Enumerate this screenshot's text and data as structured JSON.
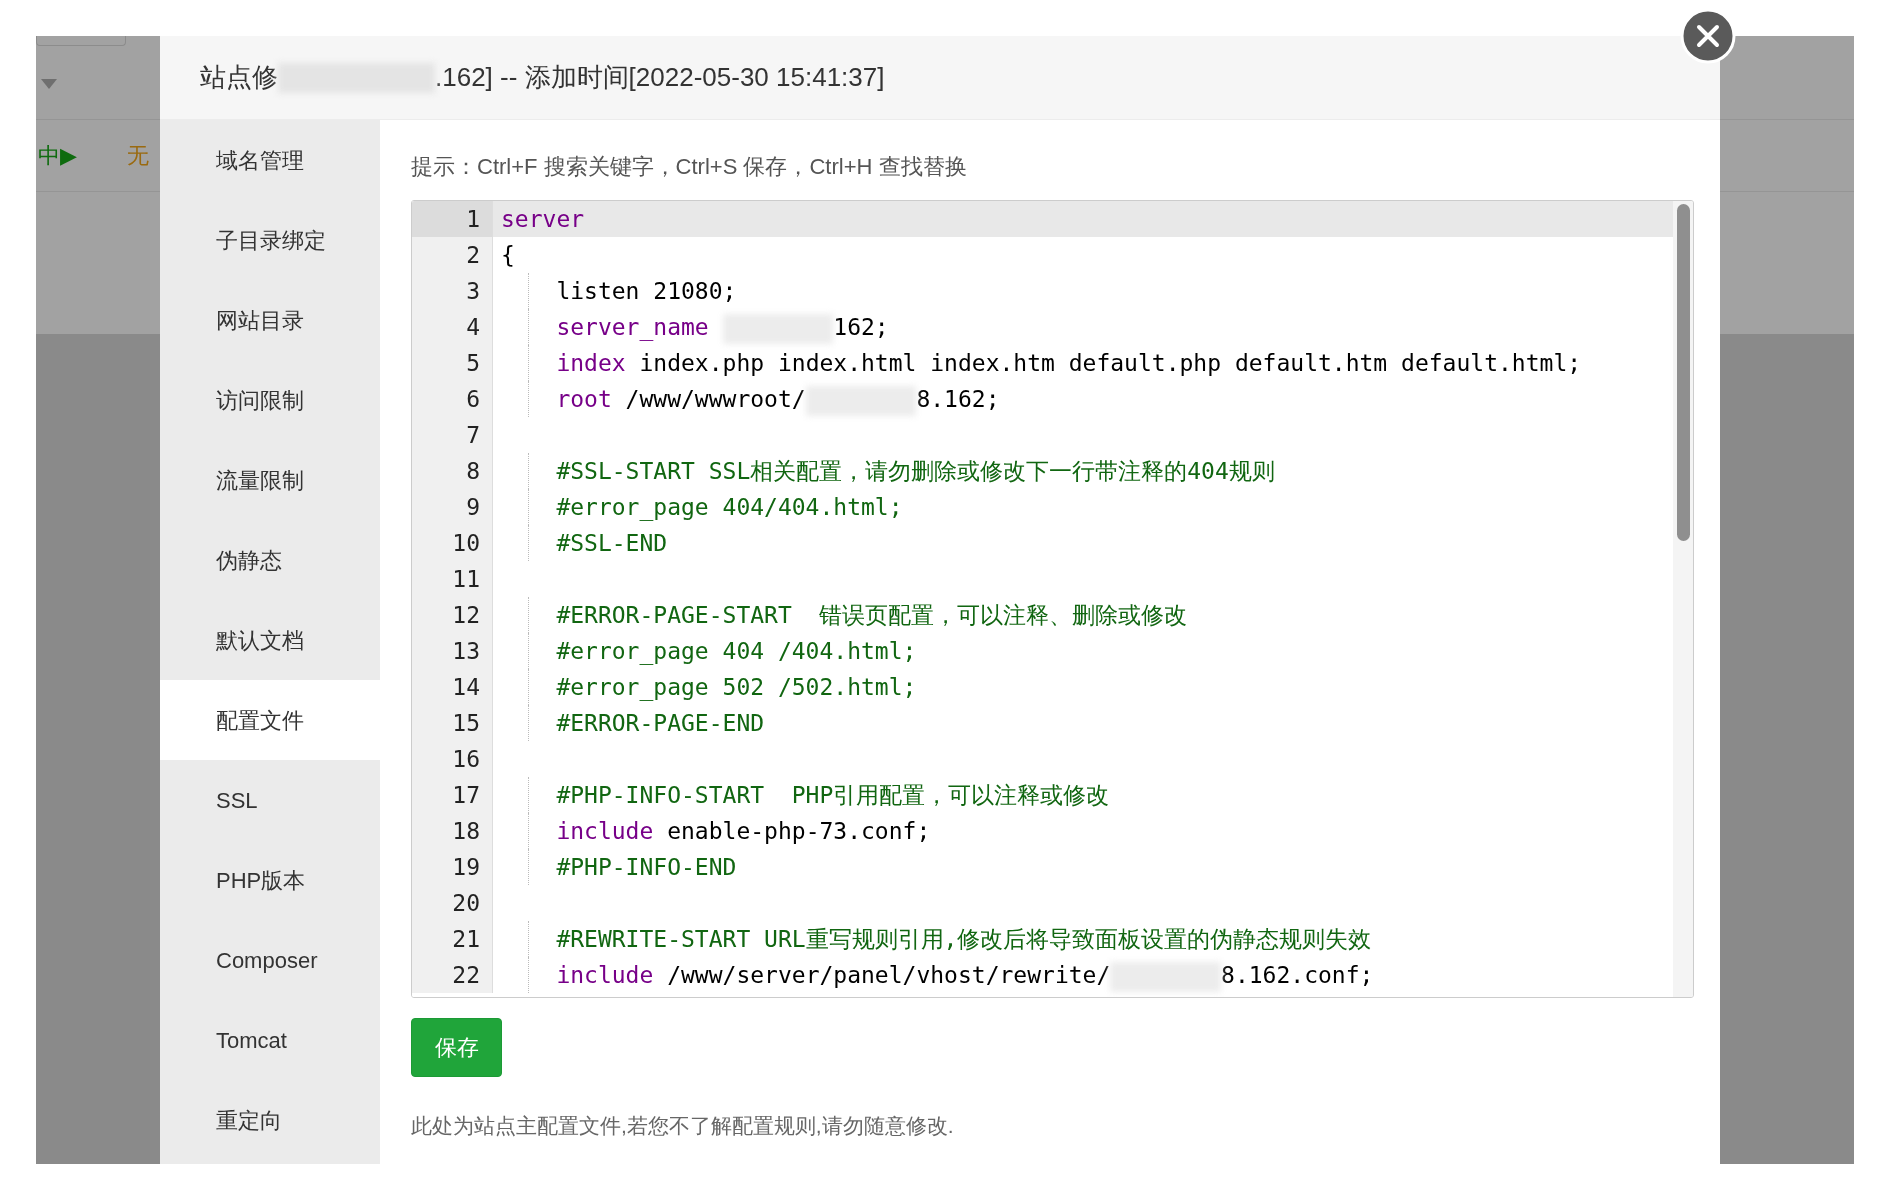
{
  "backdrop": {
    "status_text": "中",
    "status_glyph": "▶",
    "value_text": "无"
  },
  "modal": {
    "title_start": "站点修",
    "title_end": ".162] -- 添加时间[2022-05-30 15:41:37]"
  },
  "sidebar": {
    "items": [
      {
        "label": "域名管理",
        "selected": false
      },
      {
        "label": "子目录绑定",
        "selected": false
      },
      {
        "label": "网站目录",
        "selected": false
      },
      {
        "label": "访问限制",
        "selected": false
      },
      {
        "label": "流量限制",
        "selected": false
      },
      {
        "label": "伪静态",
        "selected": false
      },
      {
        "label": "默认文档",
        "selected": false
      },
      {
        "label": "配置文件",
        "selected": true
      },
      {
        "label": "SSL",
        "selected": false
      },
      {
        "label": "PHP版本",
        "selected": false
      },
      {
        "label": "Composer",
        "selected": false
      },
      {
        "label": "Tomcat",
        "selected": false
      },
      {
        "label": "重定向",
        "selected": false
      }
    ]
  },
  "hint": "提示：Ctrl+F 搜索关键字，Ctrl+S 保存，Ctrl+H 查找替换",
  "editor": {
    "lines": [
      {
        "number": "1",
        "active": true,
        "indented": false,
        "tokens": [
          {
            "kind": "keyword",
            "text": "server"
          }
        ]
      },
      {
        "number": "2",
        "active": false,
        "indented": false,
        "tokens": [
          {
            "kind": "plain",
            "text": "{"
          }
        ]
      },
      {
        "number": "3",
        "active": false,
        "indented": true,
        "tokens": [
          {
            "kind": "plain",
            "text": "listen 21080;"
          }
        ]
      },
      {
        "number": "4",
        "active": false,
        "indented": true,
        "tokens": [
          {
            "kind": "keyword",
            "text": "server_name "
          },
          {
            "kind": "redaction"
          },
          {
            "kind": "plain",
            "text": "162;"
          }
        ]
      },
      {
        "number": "5",
        "active": false,
        "indented": true,
        "tokens": [
          {
            "kind": "keyword",
            "text": "index"
          },
          {
            "kind": "plain",
            "text": " index.php index.html index.htm default.php default.htm default.html;"
          }
        ]
      },
      {
        "number": "6",
        "active": false,
        "indented": true,
        "tokens": [
          {
            "kind": "keyword",
            "text": "root"
          },
          {
            "kind": "plain",
            "text": " /www/wwwroot/"
          },
          {
            "kind": "redaction"
          },
          {
            "kind": "plain",
            "text": "8.162;"
          }
        ]
      },
      {
        "number": "7",
        "active": false,
        "indented": false
      },
      {
        "number": "8",
        "active": false,
        "indented": true,
        "tokens": [
          {
            "kind": "comment",
            "text": "#SSL-START SSL相关配置，请勿删除或修改下一行带注释的404规则"
          }
        ]
      },
      {
        "number": "9",
        "active": false,
        "indented": true,
        "tokens": [
          {
            "kind": "comment",
            "text": "#error_page 404/404.html;"
          }
        ]
      },
      {
        "number": "10",
        "active": false,
        "indented": true,
        "tokens": [
          {
            "kind": "comment",
            "text": "#SSL-END"
          }
        ]
      },
      {
        "number": "11",
        "active": false,
        "indented": false
      },
      {
        "number": "12",
        "active": false,
        "indented": true,
        "tokens": [
          {
            "kind": "comment",
            "text": "#ERROR-PAGE-START  错误页配置，可以注释、删除或修改"
          }
        ]
      },
      {
        "number": "13",
        "active": false,
        "indented": true,
        "tokens": [
          {
            "kind": "comment",
            "text": "#error_page 404 /404.html;"
          }
        ]
      },
      {
        "number": "14",
        "active": false,
        "indented": true,
        "tokens": [
          {
            "kind": "comment",
            "text": "#error_page 502 /502.html;"
          }
        ]
      },
      {
        "number": "15",
        "active": false,
        "indented": true,
        "tokens": [
          {
            "kind": "comment",
            "text": "#ERROR-PAGE-END"
          }
        ]
      },
      {
        "number": "16",
        "active": false,
        "indented": false
      },
      {
        "number": "17",
        "active": false,
        "indented": true,
        "tokens": [
          {
            "kind": "comment",
            "text": "#PHP-INFO-START  PHP引用配置，可以注释或修改"
          }
        ]
      },
      {
        "number": "18",
        "active": false,
        "indented": true,
        "tokens": [
          {
            "kind": "keyword",
            "text": "include"
          },
          {
            "kind": "plain",
            "text": " enable-php-73.conf;"
          }
        ]
      },
      {
        "number": "19",
        "active": false,
        "indented": true,
        "tokens": [
          {
            "kind": "comment",
            "text": "#PHP-INFO-END"
          }
        ]
      },
      {
        "number": "20",
        "active": false,
        "indented": false
      },
      {
        "number": "21",
        "active": false,
        "indented": true,
        "tokens": [
          {
            "kind": "comment",
            "text": "#REWRITE-START URL重写规则引用,修改后将导致面板设置的伪静态规则失效"
          }
        ]
      },
      {
        "number": "22",
        "active": false,
        "indented": true,
        "tokens": [
          {
            "kind": "keyword",
            "text": "include"
          },
          {
            "kind": "plain",
            "text": " /www/server/panel/vhost/rewrite/"
          },
          {
            "kind": "redaction"
          },
          {
            "kind": "plain",
            "text": "8.162.conf;"
          }
        ]
      }
    ]
  },
  "save_button": "保存",
  "footnote": "此处为站点主配置文件,若您不了解配置规则,请勿随意修改."
}
